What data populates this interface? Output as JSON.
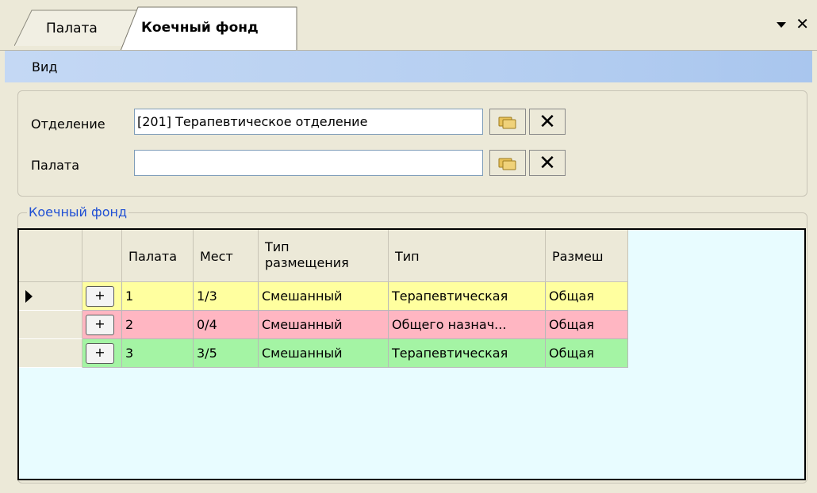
{
  "tabs": [
    {
      "label": "Палата",
      "active": false
    },
    {
      "label": "Коечный фонд",
      "active": true
    }
  ],
  "menu": {
    "items": [
      "Вид"
    ]
  },
  "filters": {
    "department_label": "Отделение",
    "department_value": "[201] Терапевтическое отделение",
    "ward_label": "Палата",
    "ward_value": ""
  },
  "group_title": "Коечный фонд",
  "grid": {
    "columns": [
      "Палата",
      "Мест",
      "Тип\nразмещения",
      "Тип",
      "Размеш"
    ],
    "rows": [
      {
        "ward": "1",
        "places": "1/3",
        "placement": "Смешанный",
        "type": "Терапевтическая",
        "accommodation": "Общая",
        "color": "#ffff9f"
      },
      {
        "ward": "2",
        "places": "0/4",
        "placement": "Смешанный",
        "type": "Общего назнач...",
        "accommodation": "Общая",
        "color": "#ffb6c2"
      },
      {
        "ward": "3",
        "places": "3/5",
        "placement": "Смешанный",
        "type": "Терапевтическая",
        "accommodation": "Общая",
        "color": "#a4f4a4"
      }
    ],
    "expand_symbol": "+",
    "current_row": 0
  },
  "colors": {
    "accent_text": "#1f4fd4",
    "grid_background": "#e8fcff"
  }
}
